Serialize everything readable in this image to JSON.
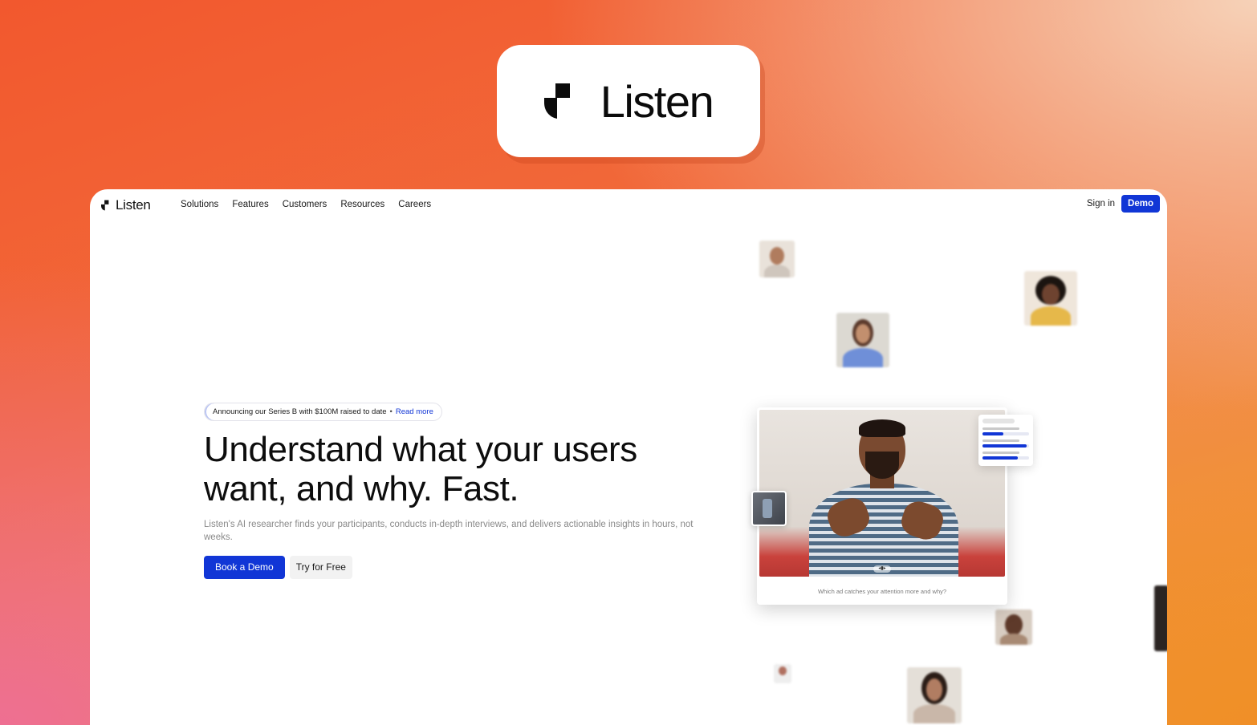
{
  "brand": {
    "name": "Listen"
  },
  "nav": {
    "logo_text": "Listen",
    "links": [
      "Solutions",
      "Features",
      "Customers",
      "Resources",
      "Careers"
    ],
    "sign_in": "Sign in",
    "demo": "Demo"
  },
  "hero": {
    "announcement": "Announcing our Series B with $100M raised to date",
    "announcement_separator": "•",
    "announcement_link": "Read more",
    "title": "Understand what your users want, and why. Fast.",
    "subtitle": "Listen's AI researcher finds your participants, conducts in-depth interviews, and delivers actionable insights in hours, not weeks.",
    "cta_primary": "Book a Demo",
    "cta_secondary": "Try for Free"
  },
  "video": {
    "caption": "Which ad catches your attention more and why?",
    "control_glyph": "◂▮▸"
  },
  "metrics": {
    "fills": [
      0.45,
      0.95,
      0.75
    ]
  },
  "colors": {
    "accent": "#1136d6",
    "background_primary": "#f2582e",
    "background_secondary": "#f39a3c"
  }
}
